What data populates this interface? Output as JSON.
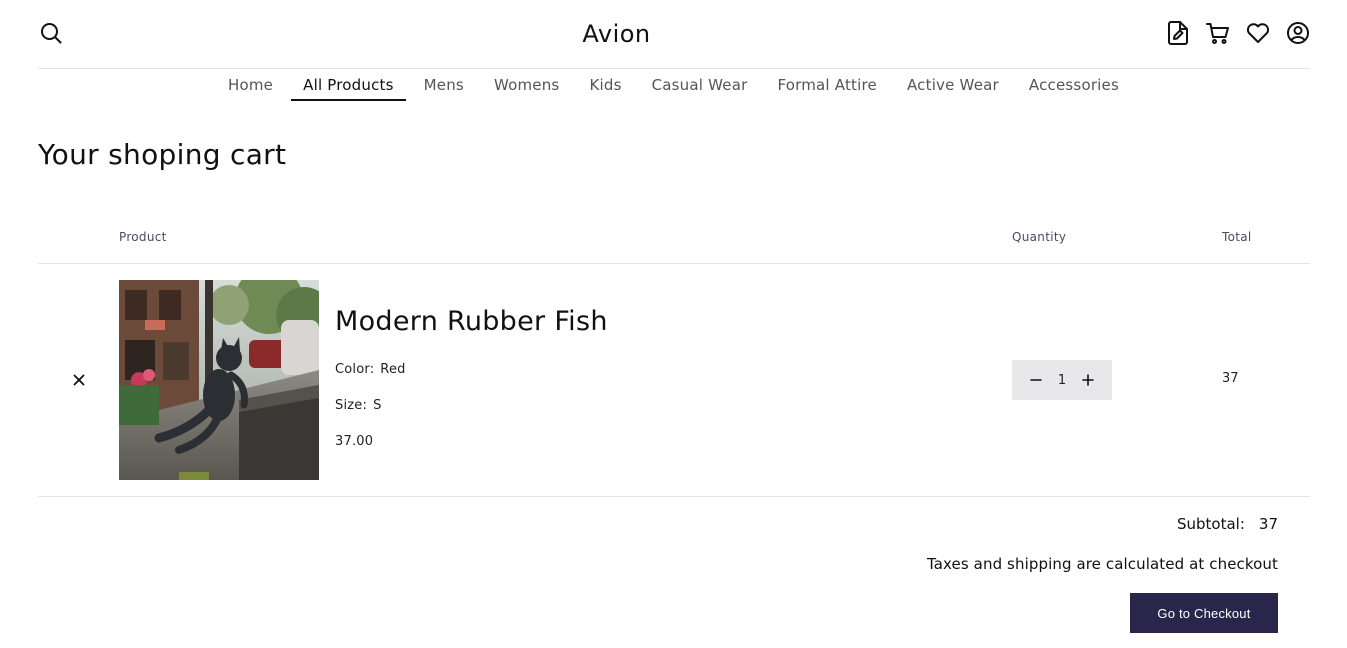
{
  "header": {
    "logo": "Avion",
    "icons": [
      "search-icon",
      "document-edit-icon",
      "cart-icon",
      "heart-icon",
      "user-circle-icon"
    ]
  },
  "nav": {
    "items": [
      "Home",
      "All Products",
      "Mens",
      "Womens",
      "Kids",
      "Casual Wear",
      "Formal Attire",
      "Active Wear",
      "Accessories"
    ],
    "active": "All Products"
  },
  "page": {
    "title": "Your shoping cart"
  },
  "table": {
    "headers": {
      "product": "Product",
      "quantity": "Quantity",
      "total": "Total"
    }
  },
  "cart": {
    "items": [
      {
        "name": "Modern Rubber Fish",
        "color_label": "Color:",
        "color": "Red",
        "size_label": "Size:",
        "size": "S",
        "price": "37.00",
        "quantity": "1",
        "total": "37",
        "remove_icon": "close-icon",
        "image": "photo of a cat statue on a street"
      }
    ]
  },
  "summary": {
    "subtotal_label": "Subtotal:",
    "subtotal_value": "37",
    "tax_note": "Taxes and shipping are calculated at checkout",
    "checkout_label": "Go to Checkout"
  },
  "colors": {
    "accent": "#2a254b",
    "qty_bg": "#e8e8ea",
    "divider": "#e6e6e6"
  }
}
